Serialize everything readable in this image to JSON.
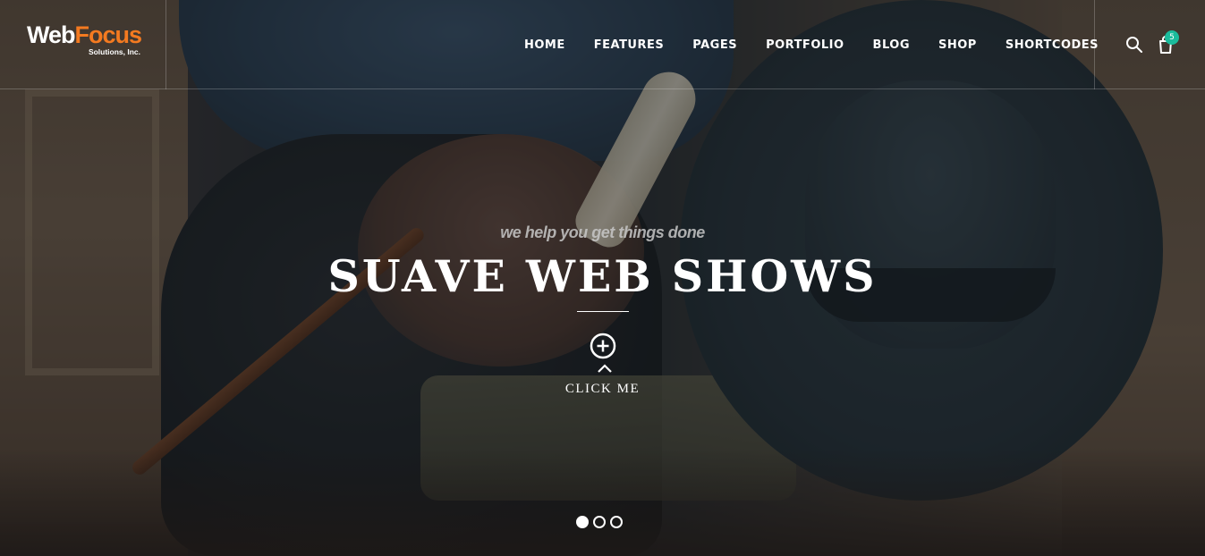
{
  "brand": {
    "logo_primary": "Web",
    "logo_accent": "Focus",
    "logo_subtitle": "Solutions, Inc.",
    "accent_color": "#f47a20"
  },
  "nav": {
    "items": [
      {
        "label": "HOME"
      },
      {
        "label": "FEATURES"
      },
      {
        "label": "PAGES"
      },
      {
        "label": "PORTFOLIO"
      },
      {
        "label": "BLOG"
      },
      {
        "label": "SHOP"
      },
      {
        "label": "SHORTCODES"
      }
    ]
  },
  "tools": {
    "search_icon": "search-icon",
    "cart_icon": "shopping-bag-icon",
    "cart_count": "5",
    "badge_color": "#1abc9c"
  },
  "hero": {
    "tagline": "we help you get things done",
    "headline": "SUAVE WEB SHOWS",
    "cta_icon": "plus-circle-icon",
    "cta_label": "CLICK ME"
  },
  "slider": {
    "slide_count": 3,
    "active_slide": 1
  }
}
